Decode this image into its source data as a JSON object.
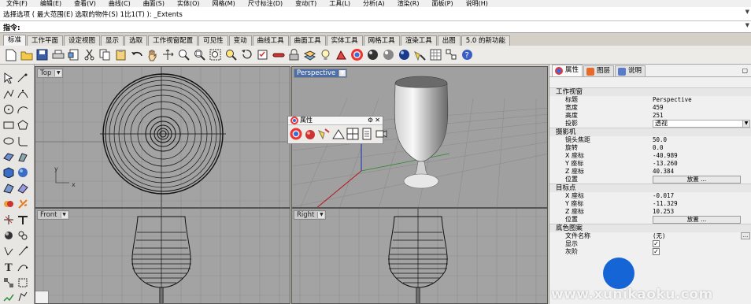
{
  "menubar": [
    "文件(F)",
    "编辑(E)",
    "查看(V)",
    "曲线(C)",
    "曲面(S)",
    "实体(O)",
    "网格(M)",
    "尺寸标注(D)",
    "变动(T)",
    "工具(L)",
    "分析(A)",
    "渲染(R)",
    "面板(P)",
    "说明(H)"
  ],
  "command_history": "选择选项 ( 最大范围(E)  选取的物件(S)  1比1(T) ): _Extents",
  "command_prompt": "指令:",
  "tabs": [
    "标准",
    "工作平面",
    "设定视图",
    "显示",
    "选取",
    "工作视窗配置",
    "可见性",
    "变动",
    "曲线工具",
    "曲面工具",
    "实体工具",
    "网格工具",
    "渲染工具",
    "出图",
    "5.0 的新功能"
  ],
  "viewports": {
    "top": "Top",
    "perspective": "Perspective",
    "front": "Front",
    "right": "Right"
  },
  "axis_labels": {
    "x": "x",
    "y": "y"
  },
  "float_panel": {
    "title": "属性"
  },
  "right_panel": {
    "tabs": [
      "属性",
      "图层",
      "说明"
    ],
    "sections": {
      "viewport": "工作视窗",
      "camera": "摄影机",
      "target": "目标点",
      "background": "底色图案"
    },
    "viewport_props": [
      {
        "k": "标题",
        "v": "Perspective"
      },
      {
        "k": "宽度",
        "v": "459"
      },
      {
        "k": "高度",
        "v": "251"
      }
    ],
    "projection_label": "投影",
    "projection_value": "透视",
    "camera_props": [
      {
        "k": "镜头焦距",
        "v": "50.0"
      },
      {
        "k": "旋转",
        "v": "0.0"
      },
      {
        "k": "X 座标",
        "v": "-40.989"
      },
      {
        "k": "Y 座标",
        "v": "-13.260"
      },
      {
        "k": "Z 座标",
        "v": "40.384"
      }
    ],
    "position_label": "位置",
    "place_button": "放置 ...",
    "target_props": [
      {
        "k": "X 座标",
        "v": "-0.017"
      },
      {
        "k": "Y 座标",
        "v": "-11.329"
      },
      {
        "k": "Z 座标",
        "v": "10.253"
      }
    ],
    "filename_label": "文件名称",
    "filename_value": "(无)",
    "show_label": "显示",
    "gray_label": "灰阶"
  },
  "watermark": "www.xunikaoku.com",
  "colors": {
    "viewport_bg": "#a2a2a2",
    "perspective_bg": "#9e9e9e",
    "active_label": "#4d6fa6",
    "accent_blue": "#1565d6"
  }
}
